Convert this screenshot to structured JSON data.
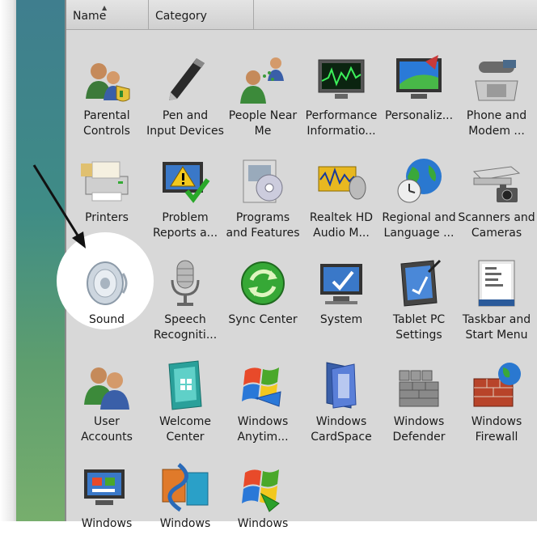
{
  "header": {
    "col_name": "Name",
    "col_category": "Category"
  },
  "items": [
    {
      "label": "Parental\nControls",
      "icon": "parental-controls-icon"
    },
    {
      "label": "Pen and\nInput Devices",
      "icon": "pen-icon"
    },
    {
      "label": "People Near\nMe",
      "icon": "people-near-me-icon"
    },
    {
      "label": "Performance\nInformatio...",
      "icon": "performance-icon"
    },
    {
      "label": "Personaliz...",
      "icon": "personalization-icon"
    },
    {
      "label": "Phone and\nModem ...",
      "icon": "phone-modem-icon"
    },
    {
      "label": "Printers",
      "icon": "printer-icon"
    },
    {
      "label": "Problem\nReports a...",
      "icon": "problem-reports-icon"
    },
    {
      "label": "Programs\nand Features",
      "icon": "programs-features-icon"
    },
    {
      "label": "Realtek HD\nAudio M...",
      "icon": "realtek-audio-icon"
    },
    {
      "label": "Regional and\nLanguage ...",
      "icon": "regional-language-icon"
    },
    {
      "label": "Scanners and\nCameras",
      "icon": "scanner-camera-icon"
    },
    {
      "label": "Sound",
      "icon": "speaker-icon"
    },
    {
      "label": "Speech\nRecogniti...",
      "icon": "microphone-icon"
    },
    {
      "label": "Sync Center",
      "icon": "sync-icon"
    },
    {
      "label": "System",
      "icon": "system-icon"
    },
    {
      "label": "Tablet PC\nSettings",
      "icon": "tablet-pc-icon"
    },
    {
      "label": "Taskbar and\nStart Menu",
      "icon": "taskbar-icon"
    },
    {
      "label": "User\nAccounts",
      "icon": "user-accounts-icon"
    },
    {
      "label": "Welcome\nCenter",
      "icon": "welcome-center-icon"
    },
    {
      "label": "Windows\nAnytim...",
      "icon": "windows-anytime-icon"
    },
    {
      "label": "Windows\nCardSpace",
      "icon": "cardspace-icon"
    },
    {
      "label": "Windows\nDefender",
      "icon": "defender-icon"
    },
    {
      "label": "Windows\nFirewall",
      "icon": "firewall-icon"
    },
    {
      "label": "Windows",
      "icon": "windows-mobility-icon"
    },
    {
      "label": "Windows",
      "icon": "windows-sideshow-icon"
    },
    {
      "label": "Windows",
      "icon": "windows-update-icon"
    }
  ]
}
